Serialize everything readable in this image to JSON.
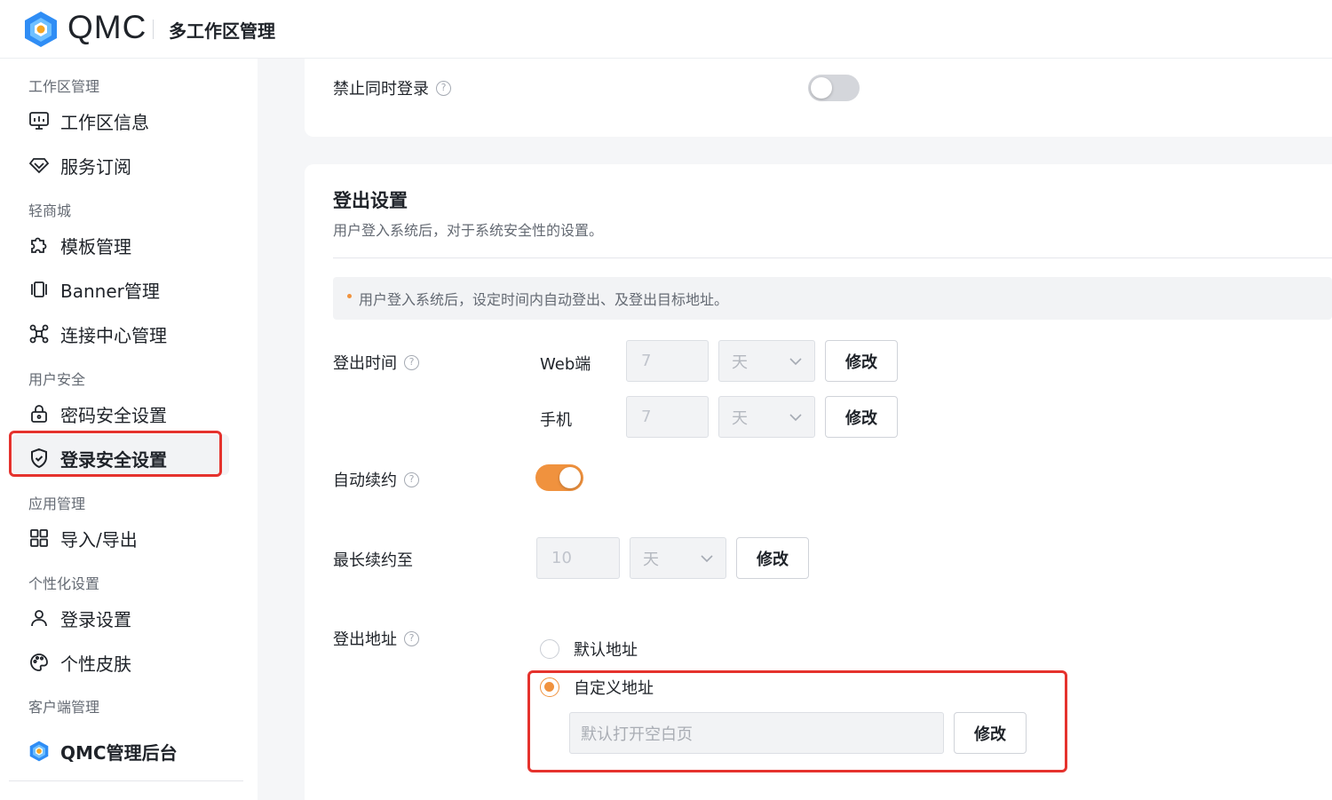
{
  "header": {
    "brand": "QMC",
    "title": "多工作区管理"
  },
  "sidebar": {
    "sections": [
      {
        "title": "工作区管理",
        "items": [
          {
            "label": "工作区信息",
            "icon": "monitor-icon"
          },
          {
            "label": "服务订阅",
            "icon": "diamond-icon"
          }
        ]
      },
      {
        "title": "轻商城",
        "items": [
          {
            "label": "模板管理",
            "icon": "puzzle-icon"
          },
          {
            "label": "Banner管理",
            "icon": "banner-icon"
          },
          {
            "label": "连接中心管理",
            "icon": "connect-icon"
          }
        ]
      },
      {
        "title": "用户安全",
        "items": [
          {
            "label": "密码安全设置",
            "icon": "lock-icon"
          },
          {
            "label": "登录安全设置",
            "icon": "shield-icon",
            "active": true
          }
        ]
      },
      {
        "title": "应用管理",
        "items": [
          {
            "label": "导入/导出",
            "icon": "grid-icon"
          }
        ]
      },
      {
        "title": "个性化设置",
        "items": [
          {
            "label": "登录设置",
            "icon": "user-icon"
          },
          {
            "label": "个性皮肤",
            "icon": "palette-icon"
          }
        ]
      },
      {
        "title": "客户端管理",
        "items": [
          {
            "label": "QMC管理后台",
            "icon": "qmc-logo-icon"
          }
        ]
      }
    ]
  },
  "main": {
    "concurrent_login": {
      "label": "禁止同时登录",
      "enabled": false
    },
    "logout_settings": {
      "title": "登出设置",
      "description": "用户登入系统后，对于系统安全性的设置。",
      "notice": "用户登入系统后，设定时间内自动登出、及登出目标地址。",
      "logout_time": {
        "label": "登出时间",
        "rows": [
          {
            "platform": "Web端",
            "value": "7",
            "unit": "天",
            "button": "修改"
          },
          {
            "platform": "手机",
            "value": "7",
            "unit": "天",
            "button": "修改"
          }
        ]
      },
      "auto_renew": {
        "label": "自动续约",
        "enabled": true
      },
      "max_renew": {
        "label": "最长续约至",
        "value": "10",
        "unit": "天",
        "button": "修改"
      },
      "logout_address": {
        "label": "登出地址",
        "options": [
          {
            "label": "默认地址",
            "checked": false
          },
          {
            "label": "自定义地址",
            "checked": true
          }
        ],
        "custom_placeholder": "默认打开空白页",
        "button": "修改"
      }
    }
  },
  "colors": {
    "accent": "#f0923e",
    "highlight": "#e5322d",
    "logo_blue": "#2f8df5",
    "logo_orange": "#f5a623"
  }
}
